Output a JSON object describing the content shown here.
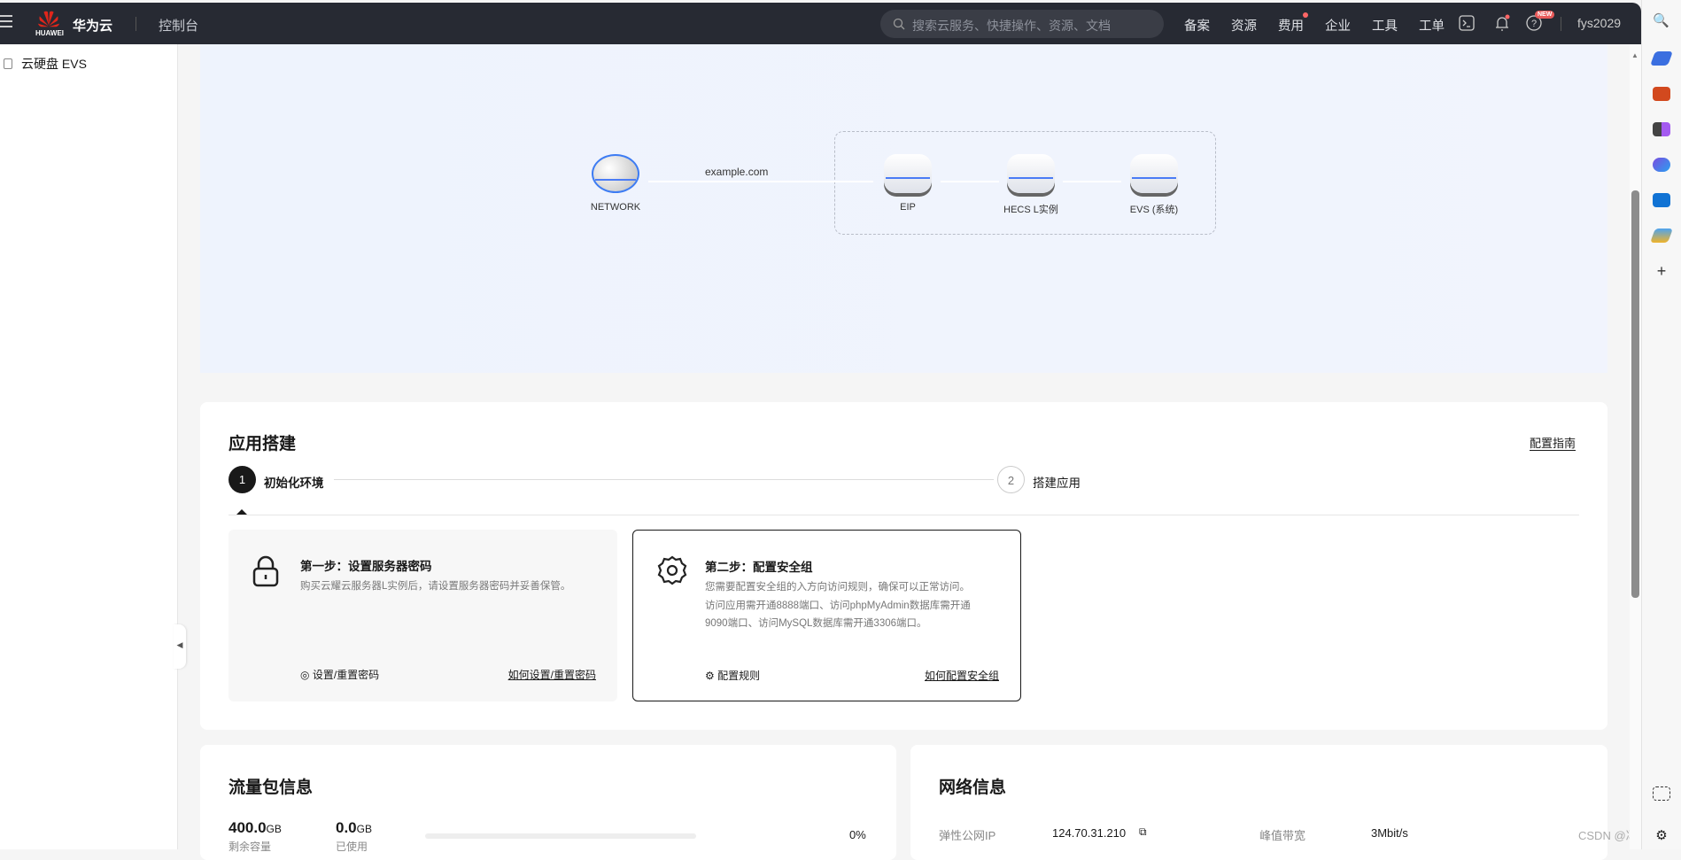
{
  "topbar": {
    "brand": "华为云",
    "logo_text": "HUAWEI",
    "console": "控制台",
    "search_placeholder": "搜索云服务、快捷操作、资源、文档",
    "nav": [
      "备案",
      "资源",
      "费用",
      "企业",
      "工具",
      "工单"
    ],
    "new_badge": "NEW",
    "user": "fys2029"
  },
  "sidebar": {
    "item": "云硬盘 EVS"
  },
  "diagram": {
    "domain": "example.com",
    "nodes": [
      "NETWORK",
      "EIP",
      "HECS L实例",
      "EVS (系统)"
    ]
  },
  "app_build": {
    "title": "应用搭建",
    "guide": "配置指南",
    "steps": [
      {
        "num": "1",
        "label": "初始化环境"
      },
      {
        "num": "2",
        "label": "搭建应用"
      }
    ],
    "cards": [
      {
        "title": "第一步：设置服务器密码",
        "desc": [
          "购买云耀云服务器L实例后，请设置服务器密码并妥善保管。"
        ],
        "action": "设置/重置密码",
        "link": "如何设置/重置密码"
      },
      {
        "title": "第二步：配置安全组",
        "desc": [
          "您需要配置安全组的入方向访问规则，确保可以正常访问。",
          "访问应用需开通8888端口、访问phpMyAdmin数据库需开通9090端口、访问MySQL数据库需开通3306端口。"
        ],
        "action": "配置规则",
        "link": "如何配置安全组"
      }
    ]
  },
  "traffic": {
    "title": "流量包信息",
    "remaining": "400.0",
    "remaining_unit": "GB",
    "remaining_label": "剩余容量",
    "used": "0.0",
    "used_unit": "GB",
    "used_label": "已使用",
    "percent": "0%",
    "percent_value": 0
  },
  "network": {
    "title": "网络信息",
    "ip_label": "弹性公网IP",
    "ip": "124.70.31.210",
    "bw_label": "峰值带宽",
    "bw": "3Mbit/s"
  },
  "watermark": "CSDN @冯运"
}
